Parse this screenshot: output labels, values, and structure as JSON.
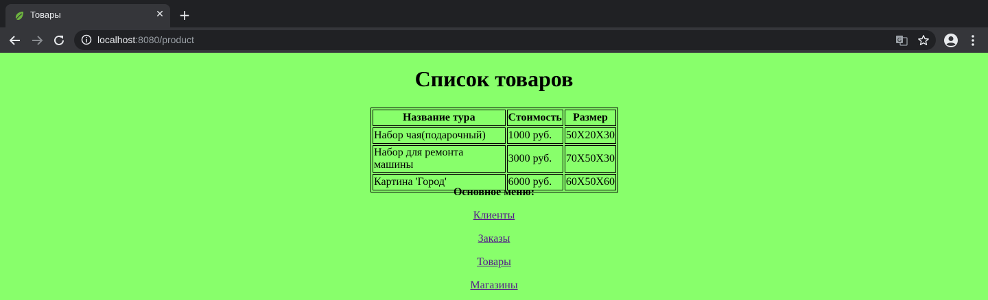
{
  "browser": {
    "tab_title": "Товары",
    "url_host": "localhost",
    "url_rest": ":8080/product"
  },
  "page": {
    "heading": "Список товаров",
    "table": {
      "headers": [
        "Название тура",
        "Стоимость",
        "Размер"
      ],
      "rows": [
        [
          "Набор чая(подарочный)",
          "1000 руб.",
          "50X20X30"
        ],
        [
          "Набор для ремонта машины",
          "3000 руб.",
          "70X50X30"
        ],
        [
          "Картина 'Город'",
          "6000 руб.",
          "60X50X60"
        ]
      ]
    },
    "menu_title": "Основное меню:",
    "menu_links": [
      "Клиенты",
      "Заказы",
      "Товары",
      "Магазины"
    ]
  },
  "colors": {
    "page_background": "#88ff6b",
    "link": "#551a8b",
    "chrome_dark": "#202124",
    "chrome_toolbar": "#35363a"
  },
  "icons": [
    "spring-leaf-icon",
    "close-icon",
    "plus-icon",
    "back-arrow-icon",
    "forward-arrow-icon",
    "reload-icon",
    "info-icon",
    "translate-icon",
    "star-icon",
    "account-icon",
    "more-vert-icon"
  ]
}
